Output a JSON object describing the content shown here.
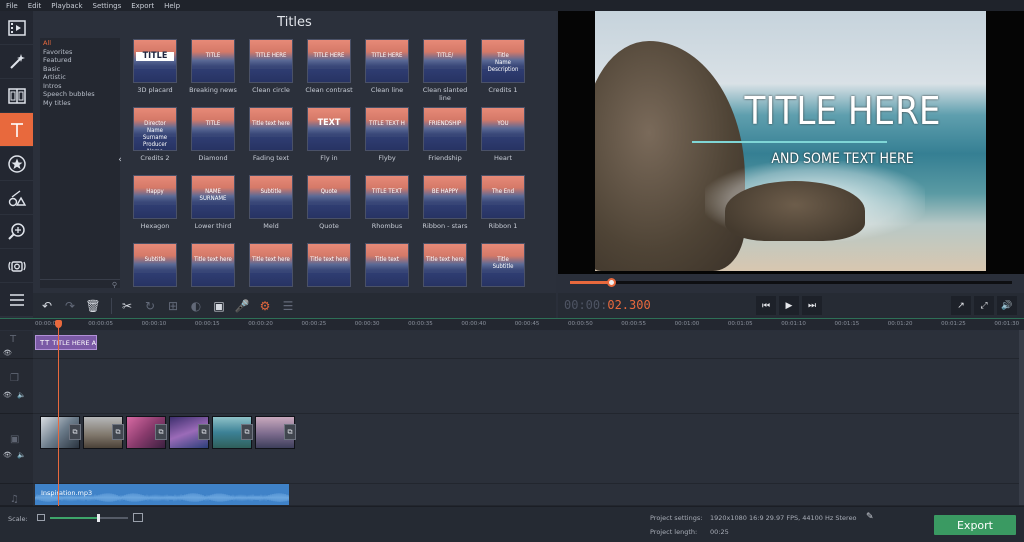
{
  "menu": [
    "File",
    "Edit",
    "Playback",
    "Settings",
    "Export",
    "Help"
  ],
  "panel": {
    "title": "Titles",
    "categories": [
      "All",
      "Favorites",
      "Featured",
      "Basic",
      "Artistic",
      "Intros",
      "Speech bubbles",
      "My titles"
    ],
    "thumbnails": [
      {
        "label": "3D placard",
        "text": "TITLE"
      },
      {
        "label": "Breaking news",
        "text": "TITLE"
      },
      {
        "label": "Clean circle",
        "text": "TITLE HERE"
      },
      {
        "label": "Clean contrast",
        "text": "TITLE HERE"
      },
      {
        "label": "Clean line",
        "text": "TITLE HERE"
      },
      {
        "label": "Clean slanted line",
        "text": "TITLE/"
      },
      {
        "label": "Credits 1",
        "text": "Title\nName Description"
      },
      {
        "label": "Credits 2",
        "text": "Director\nName Surname\nProducer\nName Surname"
      },
      {
        "label": "Diamond",
        "text": "TITLE"
      },
      {
        "label": "Fading text",
        "text": "Title text here"
      },
      {
        "label": "Fly in",
        "text": "TEXT"
      },
      {
        "label": "Flyby",
        "text": "TITLE TEXT H"
      },
      {
        "label": "Friendship",
        "text": "FRIENDSHIP"
      },
      {
        "label": "Heart",
        "text": "YOU"
      },
      {
        "label": "Hexagon",
        "text": "Happy"
      },
      {
        "label": "Lower third",
        "text": "NAME SURNAME"
      },
      {
        "label": "Meld",
        "text": "Subtitle"
      },
      {
        "label": "Quote",
        "text": "Quote"
      },
      {
        "label": "Rhombus",
        "text": "TITLE TEXT"
      },
      {
        "label": "Ribbon - stars",
        "text": "BE HAPPY"
      },
      {
        "label": "Ribbon 1",
        "text": "The End"
      },
      {
        "label": "",
        "text": "Subtitle"
      },
      {
        "label": "",
        "text": "Title text here"
      },
      {
        "label": "",
        "text": "Title text here"
      },
      {
        "label": "",
        "text": "Title text here"
      },
      {
        "label": "",
        "text": "Title text"
      },
      {
        "label": "",
        "text": "Title text here"
      },
      {
        "label": "",
        "text": "Title\nSubtitle"
      }
    ]
  },
  "preview": {
    "title_text": "TITLE HERE",
    "subtitle_text": "AND SOME TEXT HERE",
    "progress": 0.092
  },
  "playback": {
    "timecode_prefix": "00:00:",
    "timecode_current": "02.300"
  },
  "ruler": [
    "00:00:00",
    "00:00:05",
    "00:00:10",
    "00:00:15",
    "00:00:20",
    "00:00:25",
    "00:00:30",
    "00:00:35",
    "00:00:40",
    "00:00:45",
    "00:00:50",
    "00:00:55",
    "00:01:00",
    "00:01:05",
    "00:01:10",
    "00:01:15",
    "00:01:20",
    "00:01:25",
    "00:01:30"
  ],
  "timeline": {
    "title_clip": "TITLE HERE A",
    "audio_clip": "Inspiration.mp3"
  },
  "status": {
    "scale_label": "Scale:",
    "project_settings_label": "Project settings:",
    "project_settings_value": "1920x1080 16:9 29.97 FPS, 44100 Hz Stereo",
    "project_length_label": "Project length:",
    "project_length_value": "00:25",
    "scale_fraction": 0.62
  },
  "export_label": "Export",
  "colors": {
    "accent": "#e8693d",
    "export": "#3a9a62",
    "title_clip": "#7b5aa6",
    "audio_clip": "#3f82c8"
  }
}
